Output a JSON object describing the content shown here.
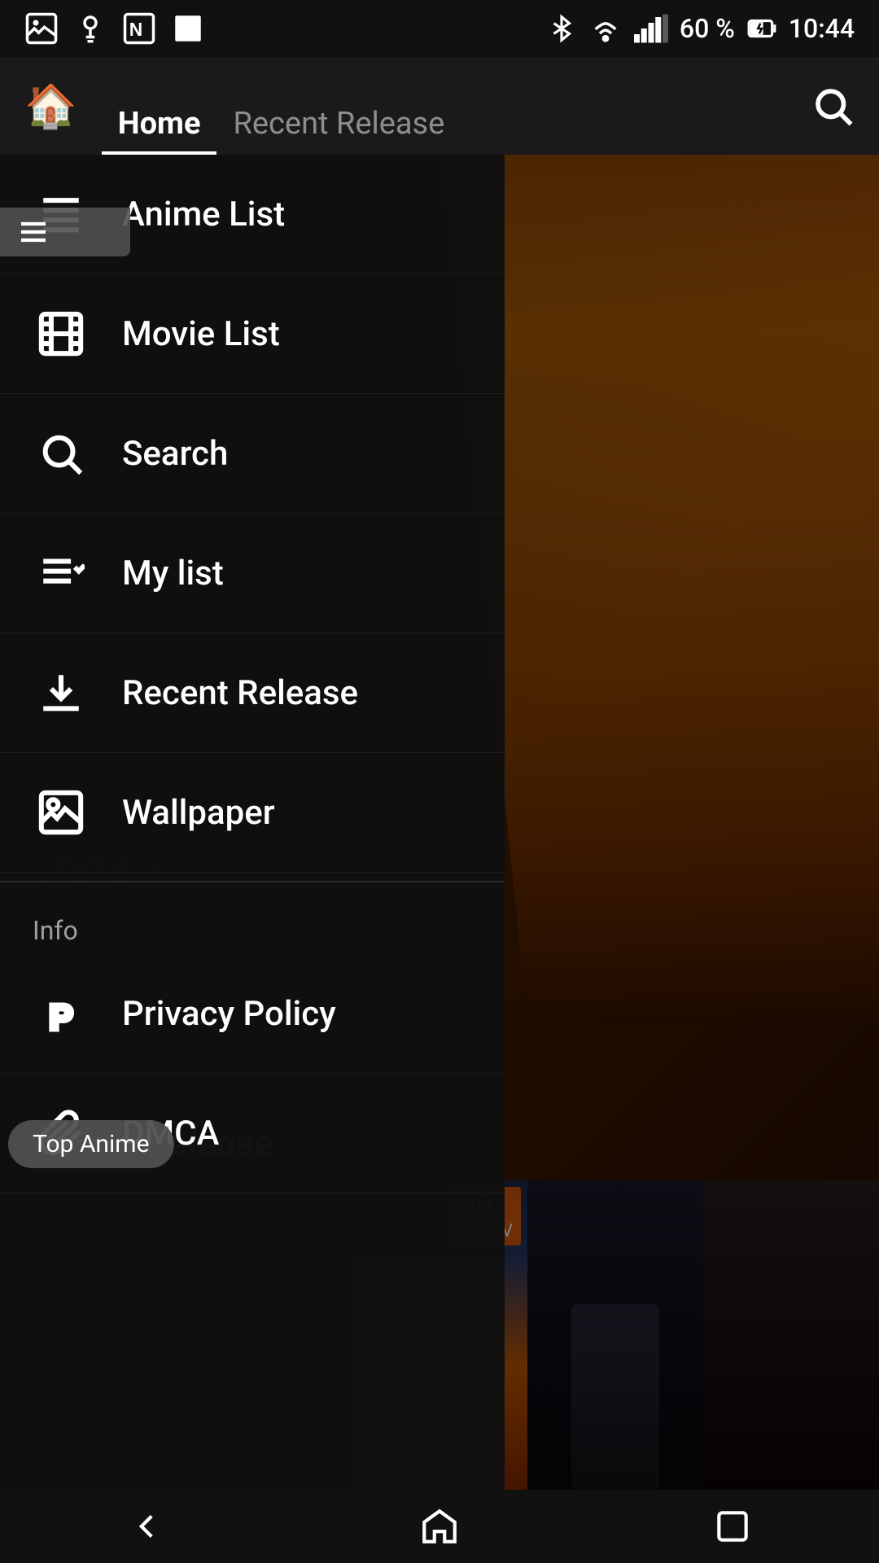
{
  "status": {
    "battery": "60 %",
    "time": "10:44",
    "icons": [
      "notification",
      "lightbulb",
      "n-badge",
      "square"
    ]
  },
  "toolbar": {
    "tabs": [
      {
        "label": "Home",
        "active": true
      },
      {
        "label": "Recent Release",
        "active": false
      }
    ],
    "search_label": "Search"
  },
  "drawer": {
    "items": [
      {
        "id": "anime-list",
        "label": "Anime List",
        "icon": "list"
      },
      {
        "id": "movie-list",
        "label": "Movie List",
        "icon": "film"
      },
      {
        "id": "search",
        "label": "Search",
        "icon": "search"
      },
      {
        "id": "my-list",
        "label": "My list",
        "icon": "checklist"
      },
      {
        "id": "recent-release",
        "label": "Recent Release",
        "icon": "download"
      },
      {
        "id": "wallpaper",
        "label": "Wallpaper",
        "icon": "image"
      }
    ],
    "info_section": "Info",
    "info_items": [
      {
        "id": "privacy-policy",
        "label": "Privacy Policy",
        "icon": "P"
      },
      {
        "id": "dmca",
        "label": "DMCA",
        "icon": "paperclip"
      }
    ]
  },
  "background": {
    "section_label": "Recent Release",
    "bg_text_news": "news :",
    "bg_text_acca": "ACCA :"
  },
  "pills": {
    "top_anime": "Top Anime"
  },
  "bottom_nav": {
    "back": "◁",
    "home": "⌂",
    "recent": "□"
  }
}
